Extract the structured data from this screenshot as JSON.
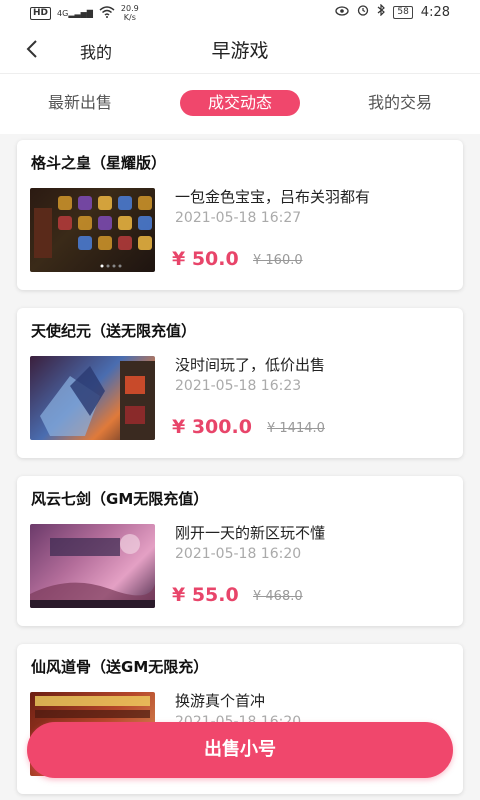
{
  "status_bar": {
    "network": "HD",
    "signal": "4G",
    "speed_value": "20.9",
    "speed_unit": "K/s",
    "battery": "58",
    "time": "4:28"
  },
  "header": {
    "back_icon": "chevron-left-icon",
    "my_label": "我的",
    "title": "早游戏"
  },
  "tabs": [
    {
      "label": "最新出售",
      "active": false
    },
    {
      "label": "成交动态",
      "active": true
    },
    {
      "label": "我的交易",
      "active": false
    }
  ],
  "cards": [
    {
      "title": "格斗之皇（星耀版）",
      "desc": "一包金色宝宝，吕布关羽都有",
      "date": "2021-05-18 16:27",
      "price": "¥ 50.0",
      "original_price": "¥ 160.0"
    },
    {
      "title": "天使纪元（送无限充值）",
      "desc": "没时间玩了，低价出售",
      "date": "2021-05-18 16:23",
      "price": "¥ 300.0",
      "original_price": "¥ 1414.0"
    },
    {
      "title": "风云七剑（GM无限充值）",
      "desc": "刚开一天的新区玩不懂",
      "date": "2021-05-18 16:20",
      "price": "¥ 55.0",
      "original_price": "¥ 468.0"
    },
    {
      "title": "仙风道骨（送GM无限充）",
      "desc": "换游真个首冲",
      "date": "2021-05-18 16:20",
      "price": "",
      "original_price": ""
    }
  ],
  "sell_button": "出售小号",
  "colors": {
    "accent": "#f0476c",
    "price": "#e8456a"
  }
}
